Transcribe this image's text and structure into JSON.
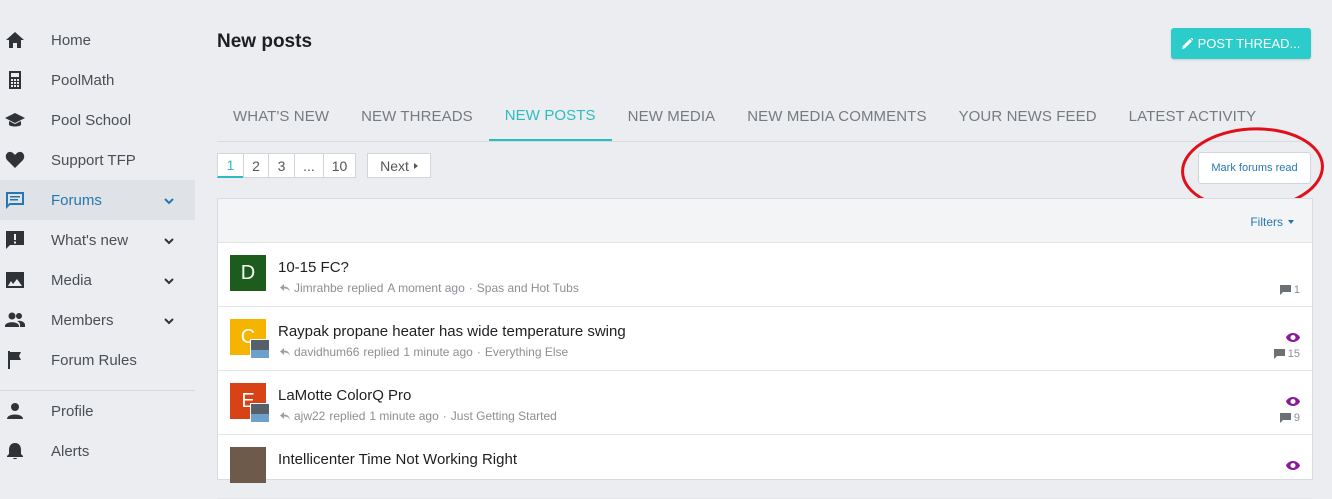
{
  "sidebar": {
    "items": [
      {
        "label": "Home",
        "icon": "home-icon"
      },
      {
        "label": "PoolMath",
        "icon": "calculator-icon"
      },
      {
        "label": "Pool School",
        "icon": "graduation-cap-icon"
      },
      {
        "label": "Support TFP",
        "icon": "heart-icon"
      },
      {
        "label": "Forums",
        "icon": "forum-icon"
      },
      {
        "label": "What's new",
        "icon": "alert-message-icon"
      },
      {
        "label": "Media",
        "icon": "image-icon"
      },
      {
        "label": "Members",
        "icon": "members-icon"
      },
      {
        "label": "Forum Rules",
        "icon": "flag-icon"
      },
      {
        "label": "Profile",
        "icon": "person-icon"
      },
      {
        "label": "Alerts",
        "icon": "bell-icon"
      }
    ]
  },
  "header": {
    "title": "New posts",
    "post_thread_label": "POST THREAD..."
  },
  "tabs": [
    "WHAT'S NEW",
    "NEW THREADS",
    "NEW POSTS",
    "NEW MEDIA",
    "NEW MEDIA COMMENTS",
    "YOUR NEWS FEED",
    "LATEST ACTIVITY"
  ],
  "pagination": {
    "pages": [
      "1",
      "2",
      "3",
      "...",
      "10"
    ],
    "next_label": "Next"
  },
  "mark_read_label": "Mark forums read",
  "filters_label": "Filters",
  "colors": {
    "accent": "#2bccc9",
    "link": "#2577b1",
    "annotation_circle": "#e0101a",
    "watched": "#8a1a9b"
  },
  "threads": [
    {
      "avatar_letter": "D",
      "avatar_color": "#1e5c1e",
      "title": "10-15 FC?",
      "user": "Jimrahbe",
      "action": "replied",
      "time": "A moment ago",
      "forum": "Spas and Hot Tubs",
      "replies": "1"
    },
    {
      "avatar_letter": "C",
      "avatar_color": "#f5b400",
      "title": "Raypak propane heater has wide temperature swing",
      "user": "davidhum66",
      "action": "replied",
      "time": "1 minute ago",
      "forum": "Everything Else",
      "replies": "15"
    },
    {
      "avatar_letter": "E",
      "avatar_color": "#d84315",
      "title": "LaMotte ColorQ Pro",
      "user": "ajw22",
      "action": "replied",
      "time": "1 minute ago",
      "forum": "Just Getting Started",
      "replies": "9"
    },
    {
      "avatar_letter": "",
      "avatar_color": "#6d5a4a",
      "title": "Intellicenter Time Not Working Right",
      "user": "",
      "action": "",
      "time": "",
      "forum": "",
      "replies": ""
    }
  ]
}
